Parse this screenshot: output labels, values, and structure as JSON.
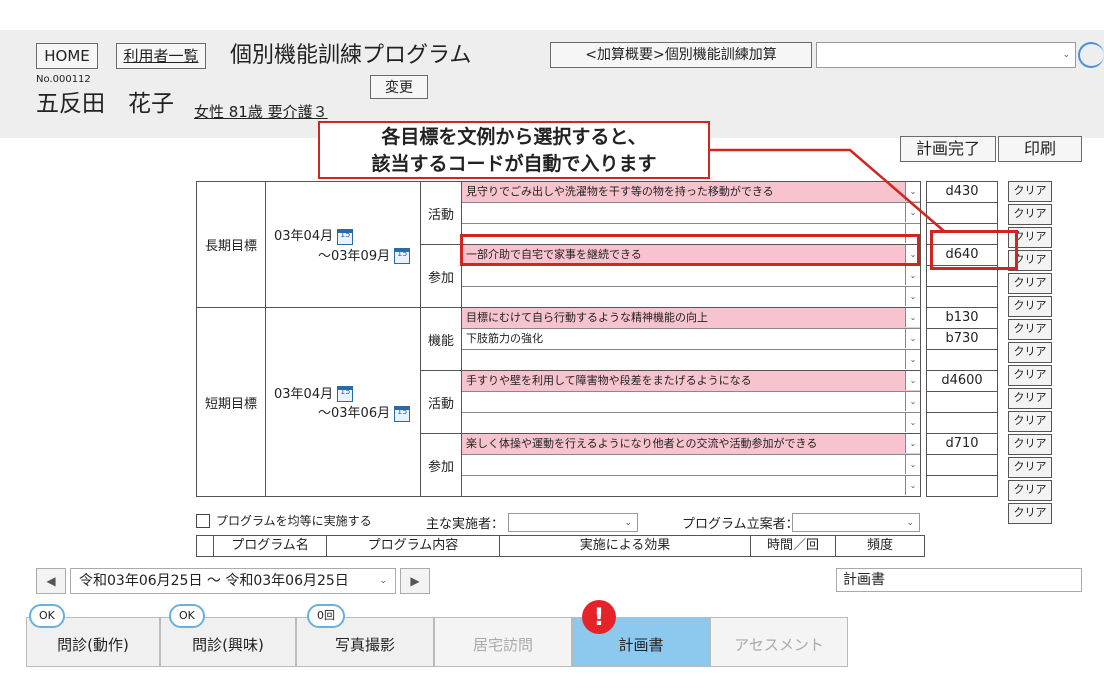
{
  "header": {
    "home_label": "HOME",
    "user_list_label": "利用者一覧",
    "page_title": "個別機能訓練プログラム",
    "addition_label": "<加算概要>個別機能訓練加算",
    "patient_no": "No.000112",
    "change_label": "変更",
    "patient_name": "五反田　花子",
    "patient_info": "女性 81歳 要介護３",
    "plan_complete_label": "計画完了",
    "print_label": "印刷"
  },
  "callout": {
    "line1": "各目標を文例から選択すると、",
    "line2": "該当するコードが自動で入ります"
  },
  "long_term": {
    "label": "長期目標",
    "start": "03年04月",
    "end": "～03年09月",
    "calendar_day": "15",
    "categories": [
      {
        "name": "活動",
        "items": [
          "見守りでごみ出しや洗濯物を干す等の物を持った移動ができる",
          "",
          ""
        ]
      },
      {
        "name": "参加",
        "items": [
          "一部介助で自宅で家事を継続できる",
          "",
          ""
        ]
      }
    ]
  },
  "short_term": {
    "label": "短期目標",
    "start": "03年04月",
    "end": "～03年06月",
    "calendar_day": "15",
    "categories": [
      {
        "name": "機能",
        "items": [
          "目標にむけて自ら行動するような精神機能の向上",
          "下肢筋力の強化",
          ""
        ]
      },
      {
        "name": "活動",
        "items": [
          "手すりや壁を利用して障害物や段差をまたげるようになる",
          "",
          ""
        ]
      },
      {
        "name": "参加",
        "items": [
          "楽しく体操や運動を行えるようになり他者との交流や活動参加ができる",
          "",
          ""
        ]
      }
    ]
  },
  "codes": [
    "d430",
    "",
    "",
    "d640",
    "",
    "",
    "b130",
    "b730",
    "",
    "d4600",
    "",
    "",
    "d710",
    "",
    ""
  ],
  "clear_label": "クリア",
  "program": {
    "equal_checkbox_label": "プログラムを均等に実施する",
    "main_performer_label": "主な実施者：",
    "planner_label": "プログラム立案者：",
    "columns": [
      "プログラム名",
      "プログラム内容",
      "実施による効果",
      "時間／回",
      "頻度"
    ]
  },
  "date_nav": {
    "range": "令和03年06月25日 ～ 令和03年06月25日",
    "prev_arrow": "◀",
    "next_arrow": "▶",
    "doc_type": "計画書"
  },
  "tabs": [
    {
      "label": "問診(動作)",
      "badge": "OK"
    },
    {
      "label": "問診(興味)",
      "badge": "OK"
    },
    {
      "label": "写真撮影",
      "badge": "0回"
    },
    {
      "label": "居宅訪問",
      "badge": ""
    },
    {
      "label": "計画書",
      "badge": ""
    },
    {
      "label": "アセスメント",
      "badge": ""
    }
  ],
  "alert_mark": "!",
  "colors": {
    "highlight_red": "#d0261d",
    "pink_row": "#f7c3cf",
    "active_tab": "#8dc9ef",
    "badge_border": "#6ab0de"
  }
}
